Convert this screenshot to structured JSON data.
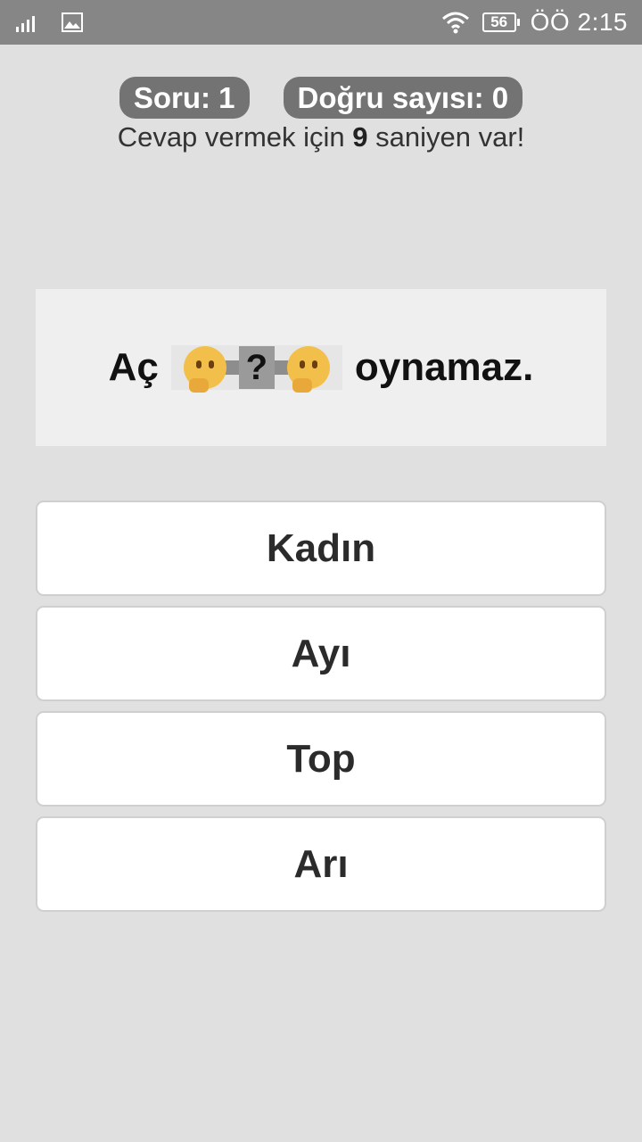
{
  "status_bar": {
    "time": "ÖÖ 2:15",
    "battery": "56",
    "icons": [
      "signal-icon",
      "gallery-icon",
      "wifi-icon",
      "battery-icon"
    ]
  },
  "header": {
    "question_label": "Soru: 1",
    "correct_label": "Doğru sayısı: 0"
  },
  "timer": {
    "prefix": "Cevap vermek için ",
    "seconds": "9",
    "suffix": " saniyen var!"
  },
  "question": {
    "before": "Aç",
    "blank_icons": [
      "thinking-face-icon",
      "question-mark-icon",
      "thinking-face-icon"
    ],
    "after": "oynamaz."
  },
  "answers": [
    {
      "label": "Kadın"
    },
    {
      "label": "Ayı"
    },
    {
      "label": "Top"
    },
    {
      "label": "Arı"
    }
  ],
  "colors": {
    "background": "#e0e0e0",
    "status_bar": "#868686",
    "pill": "#737373",
    "question_panel": "#efefef",
    "answer_button": "#ffffff"
  }
}
